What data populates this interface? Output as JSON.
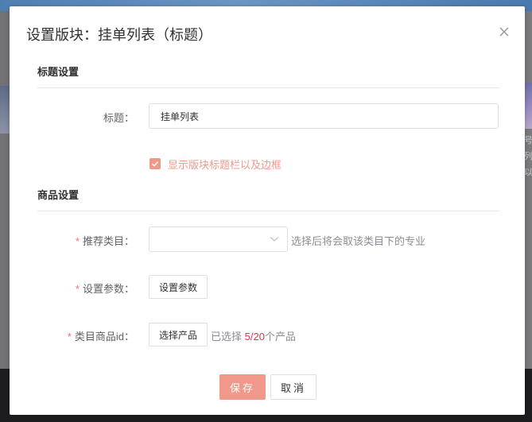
{
  "background": {
    "banner_text": "...",
    "side_text": [
      "号",
      "列",
      "以"
    ]
  },
  "modal": {
    "title": "设置版块：挂单列表（标题）",
    "close_icon": "close-icon"
  },
  "title_settings": {
    "section_title": "标题设置",
    "title_label": "标题：",
    "title_value": "挂单列表",
    "show_border_label": "显示版块标题栏以及边框",
    "show_border_checked": true
  },
  "product_settings": {
    "section_title": "商品设置",
    "category_label": "推荐类目：",
    "category_value": "",
    "category_hint": "选择后将会取该类目下的专业",
    "params_label": "设置参数：",
    "params_button": "设置参数",
    "product_id_label": "类目商品id：",
    "select_product_button": "选择产品",
    "selected_prefix": "已选择 ",
    "selected_count": "5/20",
    "selected_suffix": "个产品",
    "required_mark": "*"
  },
  "footer": {
    "save_label": "保存",
    "cancel_label": "取消"
  },
  "colors": {
    "accent": "#f0998a",
    "required": "#f56c6c",
    "count": "#e6304a"
  }
}
